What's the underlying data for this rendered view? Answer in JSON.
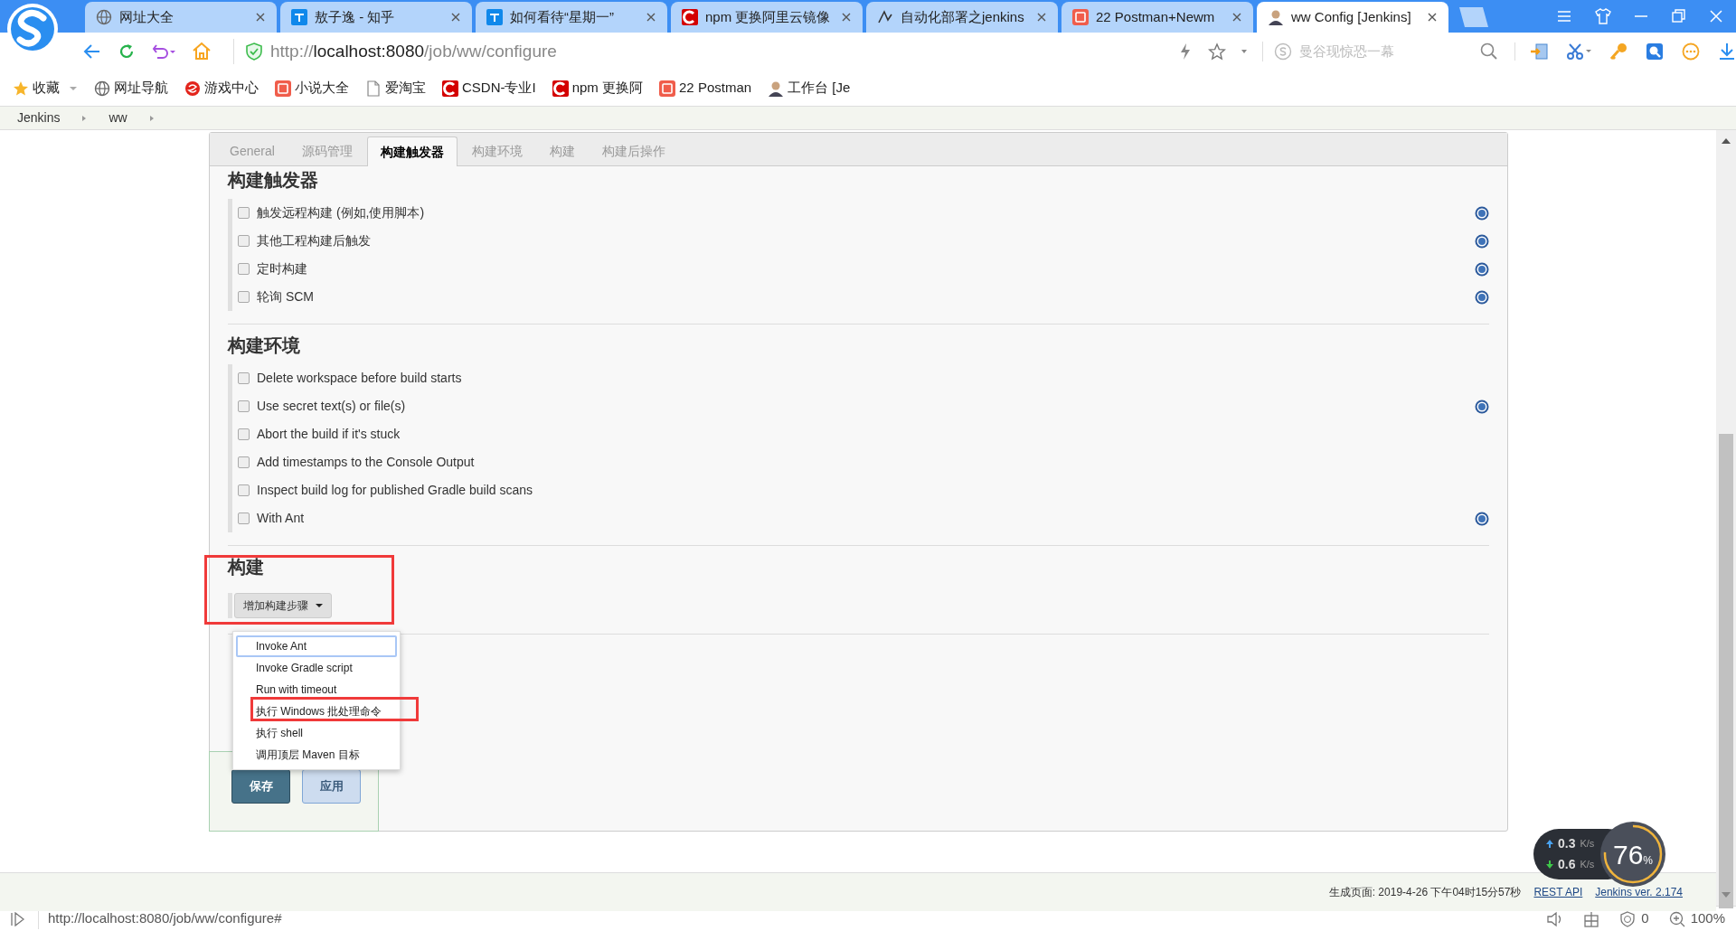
{
  "browser": {
    "tabs": [
      {
        "title": "网址大全",
        "selected": false
      },
      {
        "title": "敖子逸 - 知乎",
        "selected": false
      },
      {
        "title": "如何看待“星期一”",
        "selected": false
      },
      {
        "title": "npm 更换阿里云镜像",
        "selected": false
      },
      {
        "title": "自动化部署之jenkins",
        "selected": false
      },
      {
        "title": "22 Postman+Newm",
        "selected": false
      },
      {
        "title": "ww Config [Jenkins]",
        "selected": true
      }
    ],
    "address": {
      "scheme": "http://",
      "host": "localhost:8080",
      "path": "/job/ww/configure"
    },
    "search_placeholder": "曼谷现惊恐一幕",
    "bookmarks": [
      "收藏",
      "网址导航",
      "游戏中心",
      "小说大全",
      "爱淘宝",
      "CSDN-专业I",
      "npm 更换阿",
      "22 Postman",
      "工作台 [Je"
    ]
  },
  "breadcrumb": [
    "Jenkins",
    "ww"
  ],
  "config_tabs": [
    {
      "label": "General",
      "selected": false
    },
    {
      "label": "源码管理",
      "selected": false
    },
    {
      "label": "构建触发器",
      "selected": true
    },
    {
      "label": "构建环境",
      "selected": false
    },
    {
      "label": "构建",
      "selected": false
    },
    {
      "label": "构建后操作",
      "selected": false
    }
  ],
  "sections": [
    {
      "heading": "构建触发器",
      "options": [
        {
          "label": "触发远程构建 (例如,使用脚本)",
          "checked": false,
          "help": true
        },
        {
          "label": "其他工程构建后触发",
          "checked": false,
          "help": true
        },
        {
          "label": "定时构建",
          "checked": false,
          "help": true
        },
        {
          "label": "轮询 SCM",
          "checked": false,
          "help": true
        }
      ]
    },
    {
      "heading": "构建环境",
      "options": [
        {
          "label": "Delete workspace before build starts",
          "checked": false,
          "help": false
        },
        {
          "label": "Use secret text(s) or file(s)",
          "checked": false,
          "help": true
        },
        {
          "label": "Abort the build if it's stuck",
          "checked": false,
          "help": false
        },
        {
          "label": "Add timestamps to the Console Output",
          "checked": false,
          "help": false
        },
        {
          "label": "Inspect build log for published Gradle build scans",
          "checked": false,
          "help": false
        },
        {
          "label": "With Ant",
          "checked": false,
          "help": true
        }
      ]
    },
    {
      "heading": "构建",
      "button": "增加构建步骤"
    }
  ],
  "menu": {
    "items": [
      {
        "label": "Invoke Ant",
        "selected": true
      },
      {
        "label": "Invoke Gradle script",
        "selected": false
      },
      {
        "label": "Run with timeout",
        "selected": false
      },
      {
        "label": "执行 Windows 批处理命令",
        "selected": false
      },
      {
        "label": "执行 shell",
        "selected": false
      },
      {
        "label": "调用顶层 Maven 目标",
        "selected": false
      }
    ]
  },
  "buttons": [
    {
      "label": "保存",
      "kind": "primary"
    },
    {
      "label": "应用",
      "kind": "secondary"
    }
  ],
  "footer": {
    "generated": "生成页面: 2019-4-26 下午04时15分57秒",
    "links": [
      "REST API",
      "Jenkins ver. 2.174"
    ]
  },
  "speed_widget": {
    "upload": {
      "value": "0.3",
      "unit": "K/s"
    },
    "download": {
      "value": "0.6",
      "unit": "K/s"
    },
    "usage": "76",
    "usage_unit": "%"
  },
  "status_bar": {
    "url": "http://localhost:8080/job/ww/configure#",
    "ad_count": "0",
    "zoom": "100%"
  }
}
